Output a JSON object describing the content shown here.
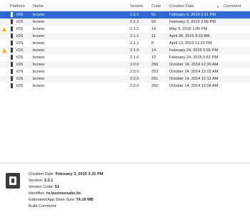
{
  "columns": {
    "platform": "Platform",
    "name": "Name",
    "version": "Version",
    "code": "Code",
    "creation_date": "Creation Date",
    "comment": "Comment"
  },
  "rows": [
    {
      "platform": "iOS",
      "name": "bcnew",
      "version": "2.2.1",
      "code": "51",
      "date": "February 3, 2019 3:21 PM",
      "warning": false,
      "selected": true
    },
    {
      "platform": "iOS",
      "name": "bcnew",
      "version": "2.2.1",
      "code": "50",
      "date": "February 3, 2019 2:56 PM",
      "warning": false,
      "selected": false
    },
    {
      "platform": "iOS",
      "name": "bcnew",
      "version": "2.1.1",
      "code": "14",
      "date": "May 9, 2015 1:05 PM",
      "warning": true,
      "selected": false
    },
    {
      "platform": "iOS",
      "name": "bcnew",
      "version": "2.1.1",
      "code": "11",
      "date": "April 28, 2015 8:23 AM",
      "warning": false,
      "selected": false
    },
    {
      "platform": "iOS",
      "name": "bcnew",
      "version": "2.1.1",
      "code": "5",
      "date": "April 13, 2015 11:20 PM",
      "warning": false,
      "selected": false
    },
    {
      "platform": "iOS",
      "name": "bcnew",
      "version": "2.1.0",
      "code": "14",
      "date": "February 24, 2015 5:55 PM",
      "warning": true,
      "selected": false
    },
    {
      "platform": "iOS",
      "name": "bcnew",
      "version": "2.1.0",
      "code": "12",
      "date": "February 24, 2015 5:51 PM",
      "warning": false,
      "selected": false
    },
    {
      "platform": "iOS",
      "name": "bcnew",
      "version": "2.0.0",
      "code": "256",
      "date": "October 14, 2014 12:30 AM",
      "warning": false,
      "selected": false
    },
    {
      "platform": "iOS",
      "name": "bcnew",
      "version": "2.0.0",
      "code": "253",
      "date": "October 14, 2014 12:15 AM",
      "warning": false,
      "selected": false
    },
    {
      "platform": "iOS",
      "name": "bcnew",
      "version": "2.0.0",
      "code": "251",
      "date": "October 14, 2014 12:13 AM",
      "warning": false,
      "selected": false
    },
    {
      "platform": "iOS",
      "name": "bcnew",
      "version": "2.0.0",
      "code": "250",
      "date": "October 14, 2014 12:08 AM",
      "warning": false,
      "selected": false
    }
  ],
  "details": {
    "creation_date_label": "Creation Date:",
    "creation_date_value": "February 3, 2019 3:21 PM",
    "version_label": "Version:",
    "version_value": "2.2.1",
    "version_code_label": "Version Code:",
    "version_code_value": "51",
    "identifier_label": "Identifier:",
    "identifier_value": "ru.businessabc.bc",
    "size_label": "Estimated App Store Size:",
    "size_value": "74.19 MB",
    "build_comment_label": "Build Comment:"
  },
  "icons": {
    "platform": "iphone-icon",
    "warning": "warning-triangle-icon",
    "sort": "sort-descending-icon",
    "app": "app-archive-icon"
  },
  "colors": {
    "selection": "#2d69d3",
    "warning": "#f0b400"
  }
}
